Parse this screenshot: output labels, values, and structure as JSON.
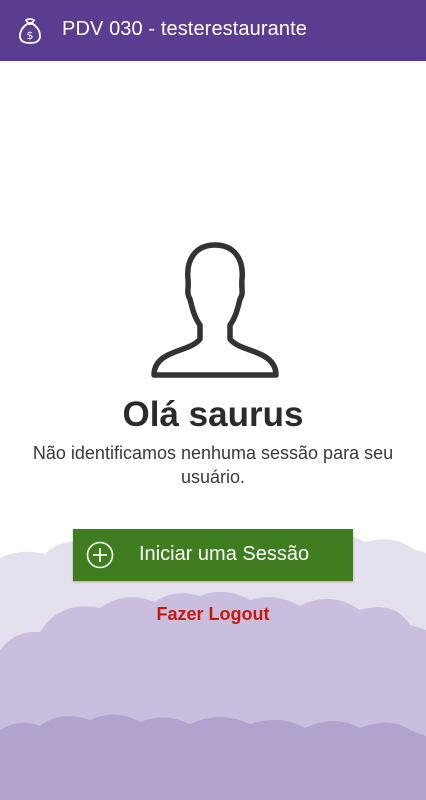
{
  "header": {
    "icon": "money-bag-icon",
    "title": "PDV 030 - testerestaurante",
    "background": "#5a3d91"
  },
  "main": {
    "avatar_icon": "user-silhouette-icon",
    "greeting": "Olá saurus",
    "message": "Não identificamos nenhuma sessão para seu usuário."
  },
  "actions": {
    "start_session": {
      "icon": "plus-circle-icon",
      "label": "Iniciar uma Sessão",
      "color": "#3f7d20"
    },
    "logout": {
      "label": "Fazer Logout",
      "color": "#c41a10"
    }
  },
  "theme": {
    "cloud_light": "#e4e0ee",
    "cloud_mid": "#c9bedd",
    "cloud_dark": "#b1a3cd"
  }
}
